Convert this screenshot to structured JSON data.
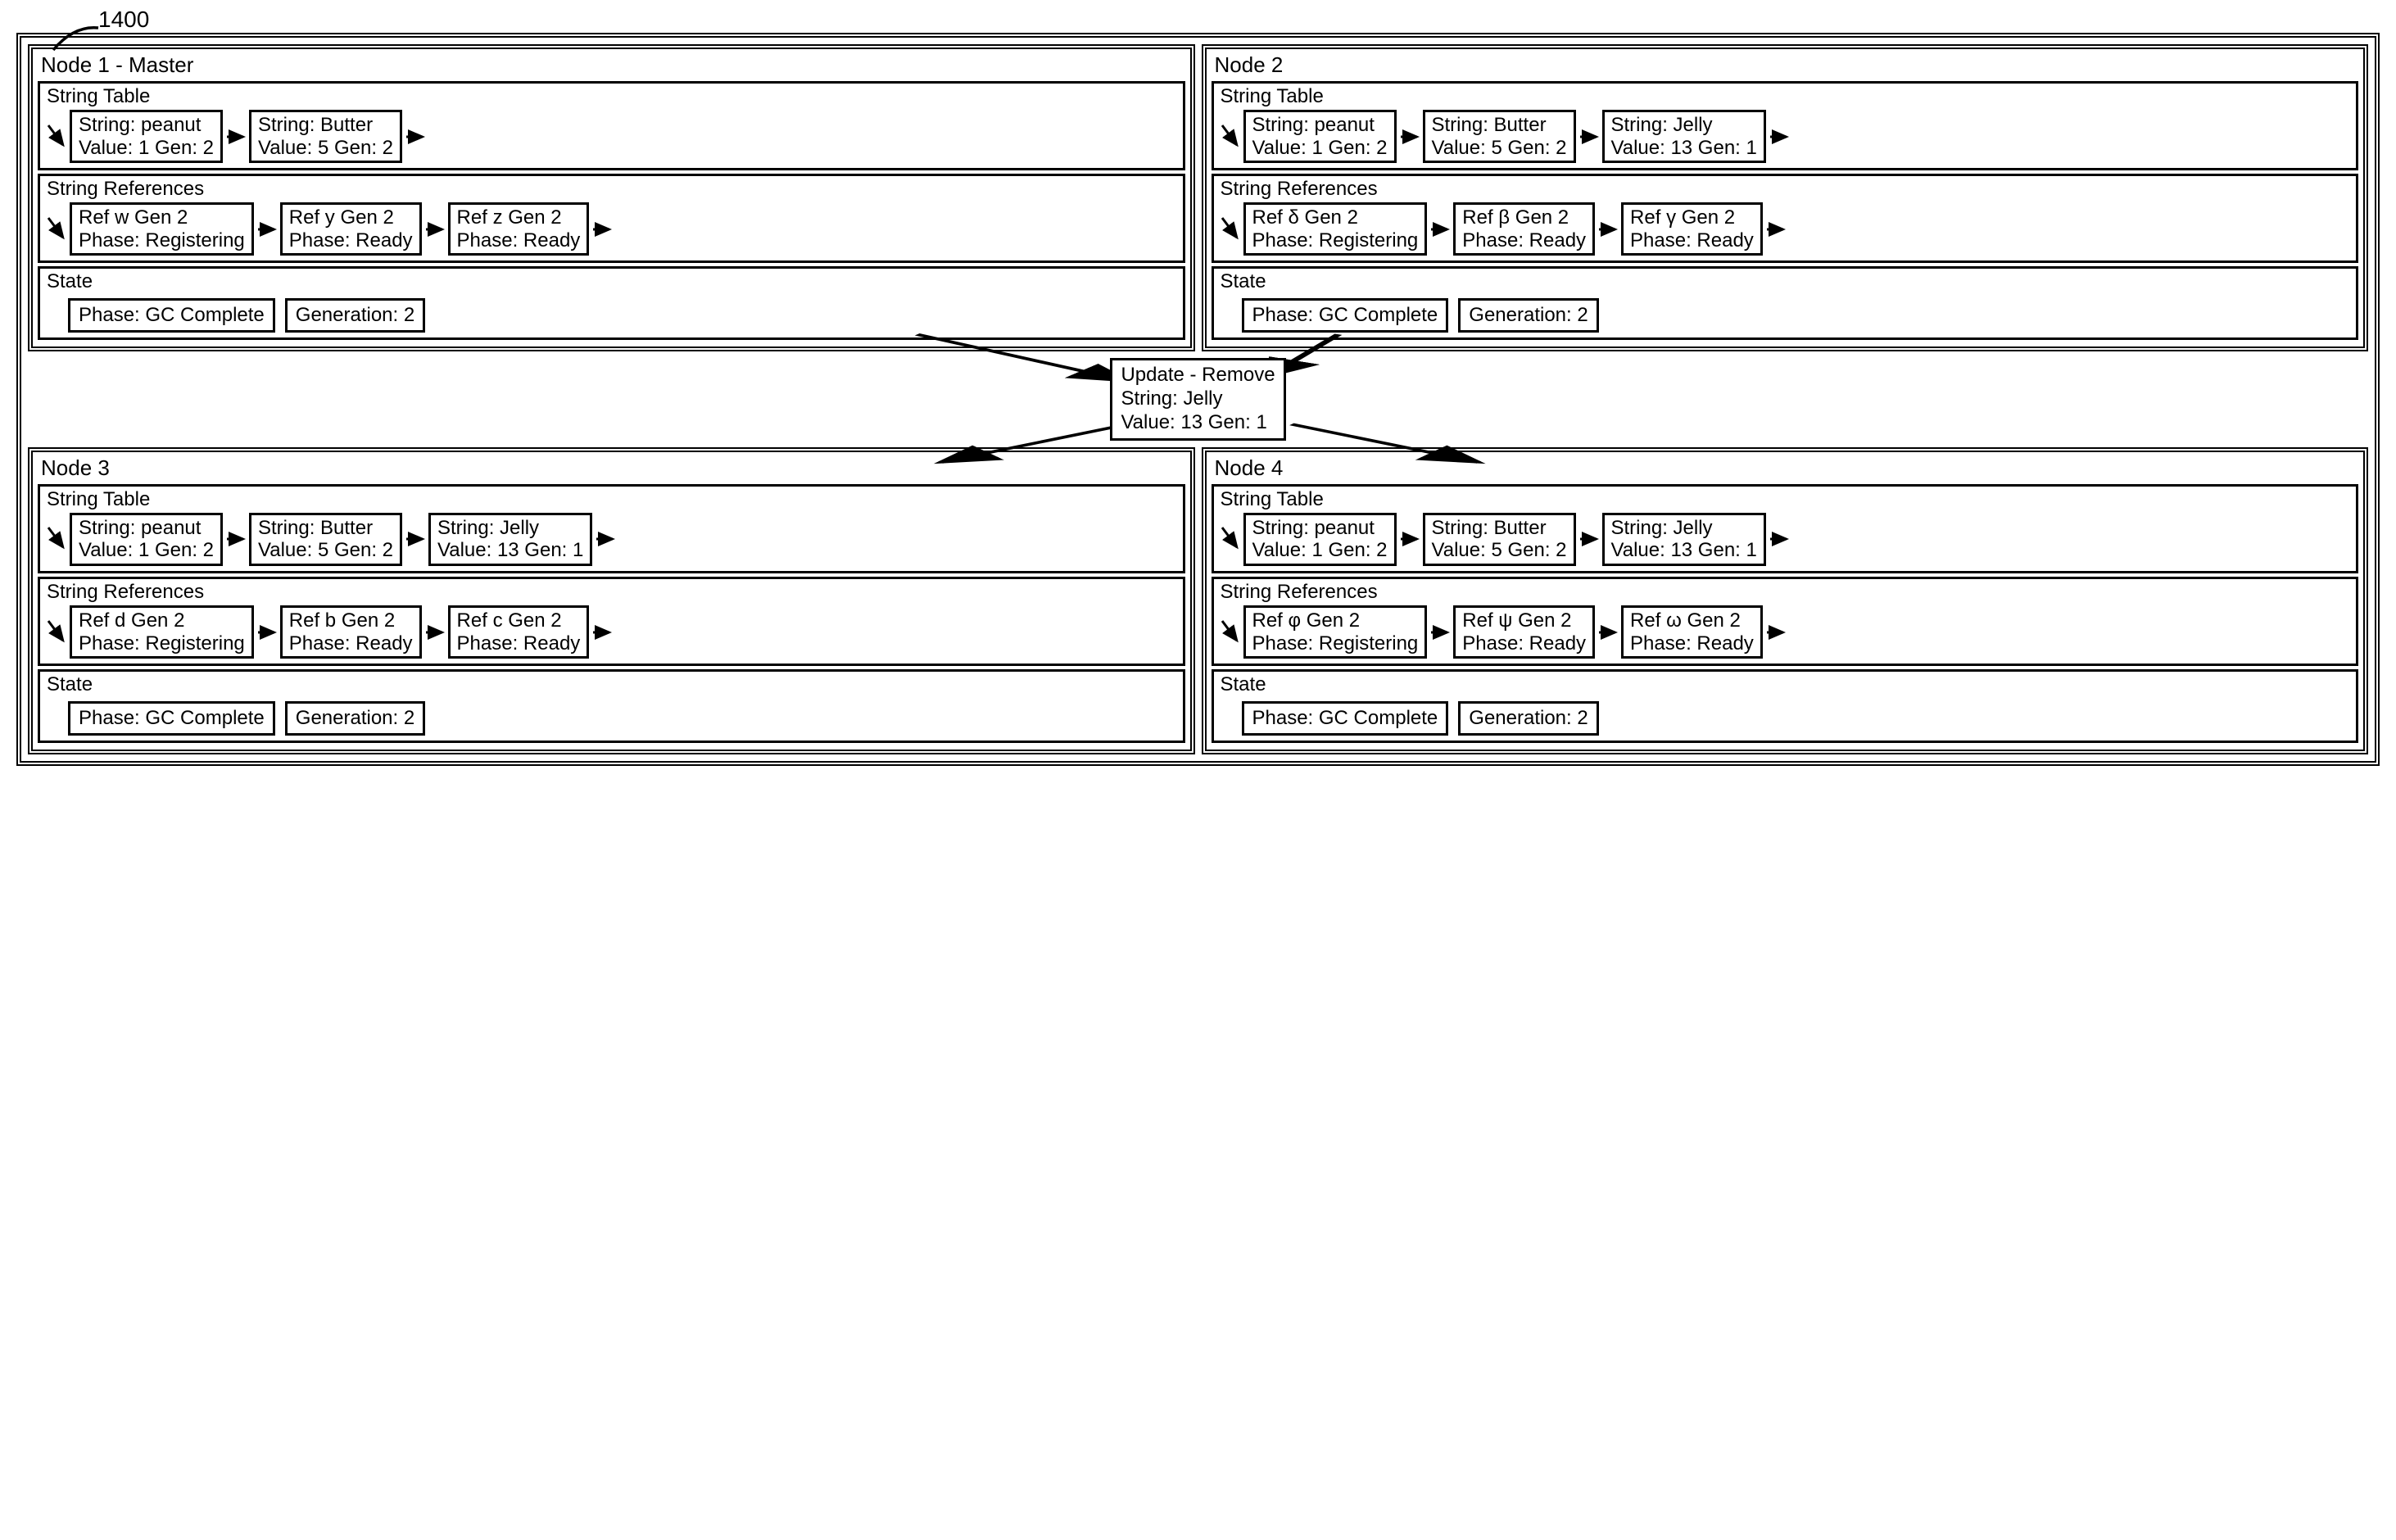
{
  "figure_ref": "1400",
  "update": {
    "title": "Update - Remove",
    "line2": "String: Jelly",
    "line3": "Value: 13 Gen: 1"
  },
  "nodes": [
    {
      "title": "Node 1 - Master",
      "stringTable": {
        "label": "String Table",
        "items": [
          {
            "l1": "String: peanut",
            "l2": "Value: 1 Gen: 2"
          },
          {
            "l1": "String: Butter",
            "l2": "Value: 5 Gen: 2"
          }
        ]
      },
      "refs": {
        "label": "String References",
        "items": [
          {
            "l1": "Ref w Gen 2",
            "l2": "Phase: Registering"
          },
          {
            "l1": "Ref y Gen 2",
            "l2": "Phase: Ready"
          },
          {
            "l1": "Ref z Gen 2",
            "l2": "Phase: Ready"
          }
        ]
      },
      "state": {
        "label": "State",
        "phase": "Phase: GC Complete",
        "gen": "Generation: 2"
      }
    },
    {
      "title": "Node 2",
      "stringTable": {
        "label": "String Table",
        "items": [
          {
            "l1": "String: peanut",
            "l2": "Value: 1 Gen: 2"
          },
          {
            "l1": "String: Butter",
            "l2": "Value: 5 Gen: 2"
          },
          {
            "l1": "String: Jelly",
            "l2": "Value: 13 Gen: 1"
          }
        ]
      },
      "refs": {
        "label": "String References",
        "items": [
          {
            "l1": "Ref δ Gen 2",
            "l2": "Phase: Registering"
          },
          {
            "l1": "Ref β Gen 2",
            "l2": "Phase: Ready"
          },
          {
            "l1": "Ref γ Gen 2",
            "l2": "Phase: Ready"
          }
        ]
      },
      "state": {
        "label": "State",
        "phase": "Phase: GC Complete",
        "gen": "Generation: 2"
      }
    },
    {
      "title": "Node 3",
      "stringTable": {
        "label": "String Table",
        "items": [
          {
            "l1": "String: peanut",
            "l2": "Value: 1 Gen: 2"
          },
          {
            "l1": "String: Butter",
            "l2": "Value: 5 Gen: 2"
          },
          {
            "l1": "String: Jelly",
            "l2": "Value: 13 Gen: 1"
          }
        ]
      },
      "refs": {
        "label": "String References",
        "items": [
          {
            "l1": "Ref d Gen 2",
            "l2": "Phase: Registering"
          },
          {
            "l1": "Ref b Gen 2",
            "l2": "Phase: Ready"
          },
          {
            "l1": "Ref c Gen 2",
            "l2": "Phase: Ready"
          }
        ]
      },
      "state": {
        "label": "State",
        "phase": "Phase: GC Complete",
        "gen": "Generation: 2"
      }
    },
    {
      "title": "Node 4",
      "stringTable": {
        "label": "String Table",
        "items": [
          {
            "l1": "String: peanut",
            "l2": "Value: 1 Gen: 2"
          },
          {
            "l1": "String: Butter",
            "l2": "Value: 5 Gen: 2"
          },
          {
            "l1": "String: Jelly",
            "l2": "Value: 13 Gen: 1"
          }
        ]
      },
      "refs": {
        "label": "String References",
        "items": [
          {
            "l1": "Ref φ Gen 2",
            "l2": "Phase: Registering"
          },
          {
            "l1": "Ref ψ Gen 2",
            "l2": "Phase: Ready"
          },
          {
            "l1": "Ref ω Gen 2",
            "l2": "Phase: Ready"
          }
        ]
      },
      "state": {
        "label": "State",
        "phase": "Phase: GC Complete",
        "gen": "Generation: 2"
      }
    }
  ]
}
